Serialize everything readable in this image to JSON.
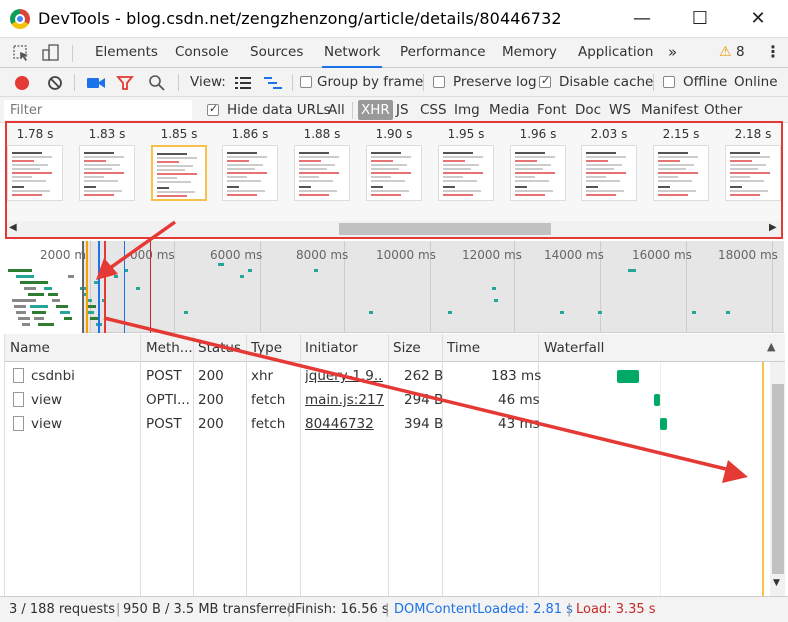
{
  "window": {
    "title": "DevTools - blog.csdn.net/zengzhenzong/article/details/80446732"
  },
  "tabs": [
    "Elements",
    "Console",
    "Sources",
    "Network",
    "Performance",
    "Memory",
    "Application"
  ],
  "warnings": {
    "count": "8"
  },
  "toolbar": {
    "view_label": "View:",
    "group_by_frame": "Group by frame",
    "preserve_log": "Preserve log",
    "disable_cache": "Disable cache",
    "offline": "Offline",
    "online": "Online"
  },
  "filter": {
    "placeholder": "Filter",
    "hide_data_urls": "Hide data URLs",
    "types": [
      "All",
      "XHR",
      "JS",
      "CSS",
      "Img",
      "Media",
      "Font",
      "Doc",
      "WS",
      "Manifest",
      "Other"
    ],
    "active_type": "XHR"
  },
  "filmstrip": {
    "frames": [
      "1.78 s",
      "1.83 s",
      "1.85 s",
      "1.86 s",
      "1.88 s",
      "1.90 s",
      "1.95 s",
      "1.96 s",
      "2.03 s",
      "2.15 s",
      "2.18 s"
    ],
    "selected_index": 2
  },
  "overview": {
    "ticks": [
      "2000 m",
      "000 ms",
      "6000 ms",
      "8000 ms",
      "10000 ms",
      "12000 ms",
      "14000 ms",
      "16000 ms",
      "18000 ms"
    ]
  },
  "table": {
    "headers": [
      "Name",
      "Meth...",
      "Status",
      "Type",
      "Initiator",
      "Size",
      "Time",
      "Waterfall"
    ],
    "rows": [
      {
        "name": "csdnbi",
        "method": "POST",
        "status": "200",
        "type": "xhr",
        "initiator": "jquery-1.9....",
        "size": "262 B",
        "time": "183 ms"
      },
      {
        "name": "view",
        "method": "OPTI...",
        "status": "200",
        "type": "fetch",
        "initiator": "main.js:217",
        "size": "294 B",
        "time": "46 ms"
      },
      {
        "name": "view",
        "method": "POST",
        "status": "200",
        "type": "fetch",
        "initiator": "80446732",
        "size": "394 B",
        "time": "43 ms"
      }
    ]
  },
  "status": {
    "requests": "3 / 188 requests",
    "transferred": "950 B / 3.5 MB transferred",
    "finish": "Finish: 16.56 s",
    "dom_loaded": "DOMContentLoaded: 2.81 s",
    "load": "Load: 3.35 s"
  },
  "colors": {
    "accent": "#1a73e8",
    "record": "#e53935",
    "dom_blue": "#1a73e8",
    "load_red": "#c62828",
    "annotation": "#e53935"
  }
}
